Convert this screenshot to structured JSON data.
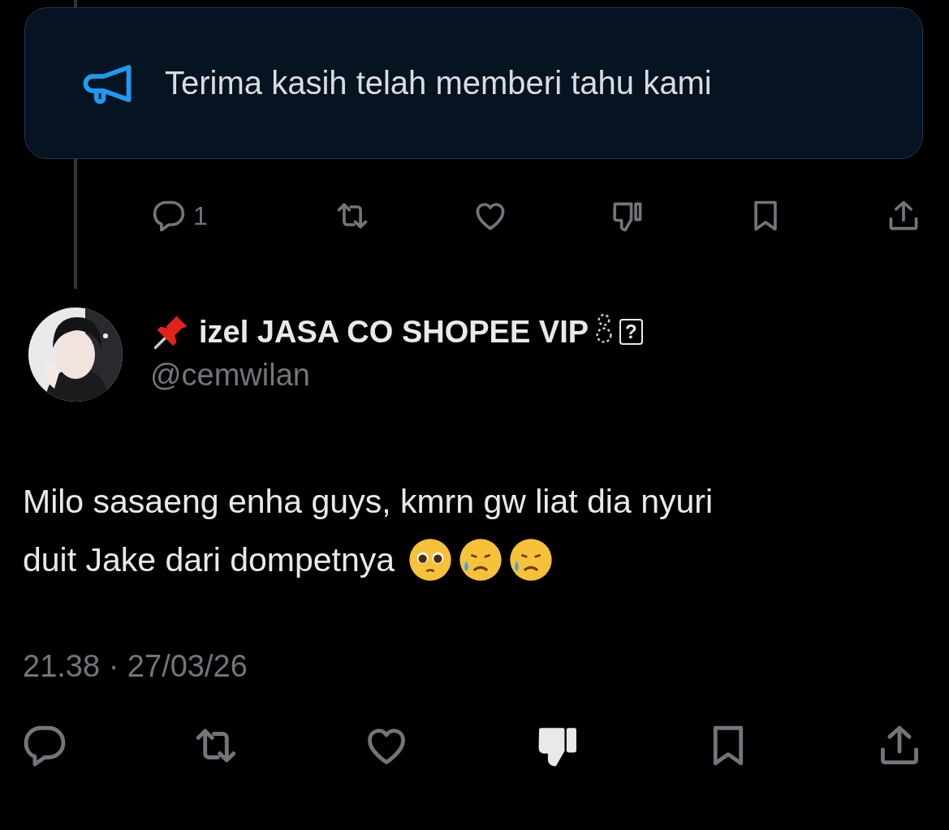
{
  "toast": {
    "message": "Terima kasih telah memberi tahu kami"
  },
  "previous_tweet": {
    "actions": [
      {
        "kind": "reply",
        "count": "1"
      },
      {
        "kind": "repost",
        "on": false
      },
      {
        "kind": "like",
        "on": false
      },
      {
        "kind": "dislike",
        "on": false
      },
      {
        "kind": "bookmark",
        "on": false
      },
      {
        "kind": "share"
      }
    ]
  },
  "tweet": {
    "display_name": "izel JASA CO SHOPEE VIP",
    "unknown_glyph": "?",
    "handle": "@cemwilan",
    "text_lines": [
      "Milo sasaeng enha guys, kmrn gw liat dia nyuri",
      "duit Jake dari dompetnya"
    ],
    "timestamp": "21.38 · 27/03/26",
    "actions": [
      {
        "kind": "reply"
      },
      {
        "kind": "repost",
        "on": false
      },
      {
        "kind": "like",
        "on": false
      },
      {
        "kind": "dislike",
        "on": true
      },
      {
        "kind": "bookmark",
        "on": false
      },
      {
        "kind": "share"
      }
    ]
  }
}
